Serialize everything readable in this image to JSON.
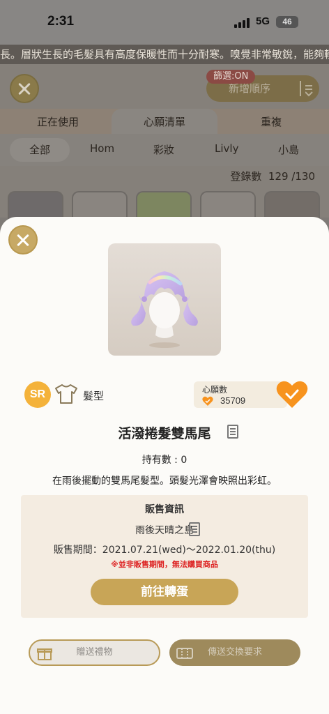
{
  "status_bar": {
    "time": "2:31",
    "network": "5G",
    "battery": "46"
  },
  "ticker": {
    "text": "長。層狀生長的毛髮具有高度保暖性而十分耐寒。嗅覺非常敏銳，能夠輕"
  },
  "background": {
    "filter_badge": "篩選:ON",
    "sort_label": "新增順序",
    "tabs": [
      "正在使用",
      "心願清單",
      "重複"
    ],
    "subtabs": [
      "全部",
      "Hom",
      "彩妝",
      "Livly",
      "小島"
    ],
    "count_label": "登錄數",
    "count_value": "129 /130"
  },
  "item": {
    "rarity": "SR",
    "category": "髮型",
    "wish_label": "心願數",
    "wish_count": "35709",
    "name": "活潑捲髮雙馬尾",
    "owned": "持有數 : 0",
    "description": "在雨後擺動的雙馬尾髮型。頭髮光澤會映照出彩虹。"
  },
  "sale_info": {
    "title": "販售資訊",
    "location": "雨後天晴之島",
    "period": "販售期間：2021.07.21(wed)～2022.01.20(thu)",
    "warning": "※並非販售期間，無法購買商品",
    "gacha_button": "前往轉蛋"
  },
  "actions": {
    "gift_label": "贈送禮物",
    "trade_label": "傳送交換要求"
  },
  "colors": {
    "accent_gold": "#c8a557",
    "rarity_orange": "#f4b23a",
    "heart_orange": "#f7931e",
    "warning_red": "#dd2222"
  }
}
